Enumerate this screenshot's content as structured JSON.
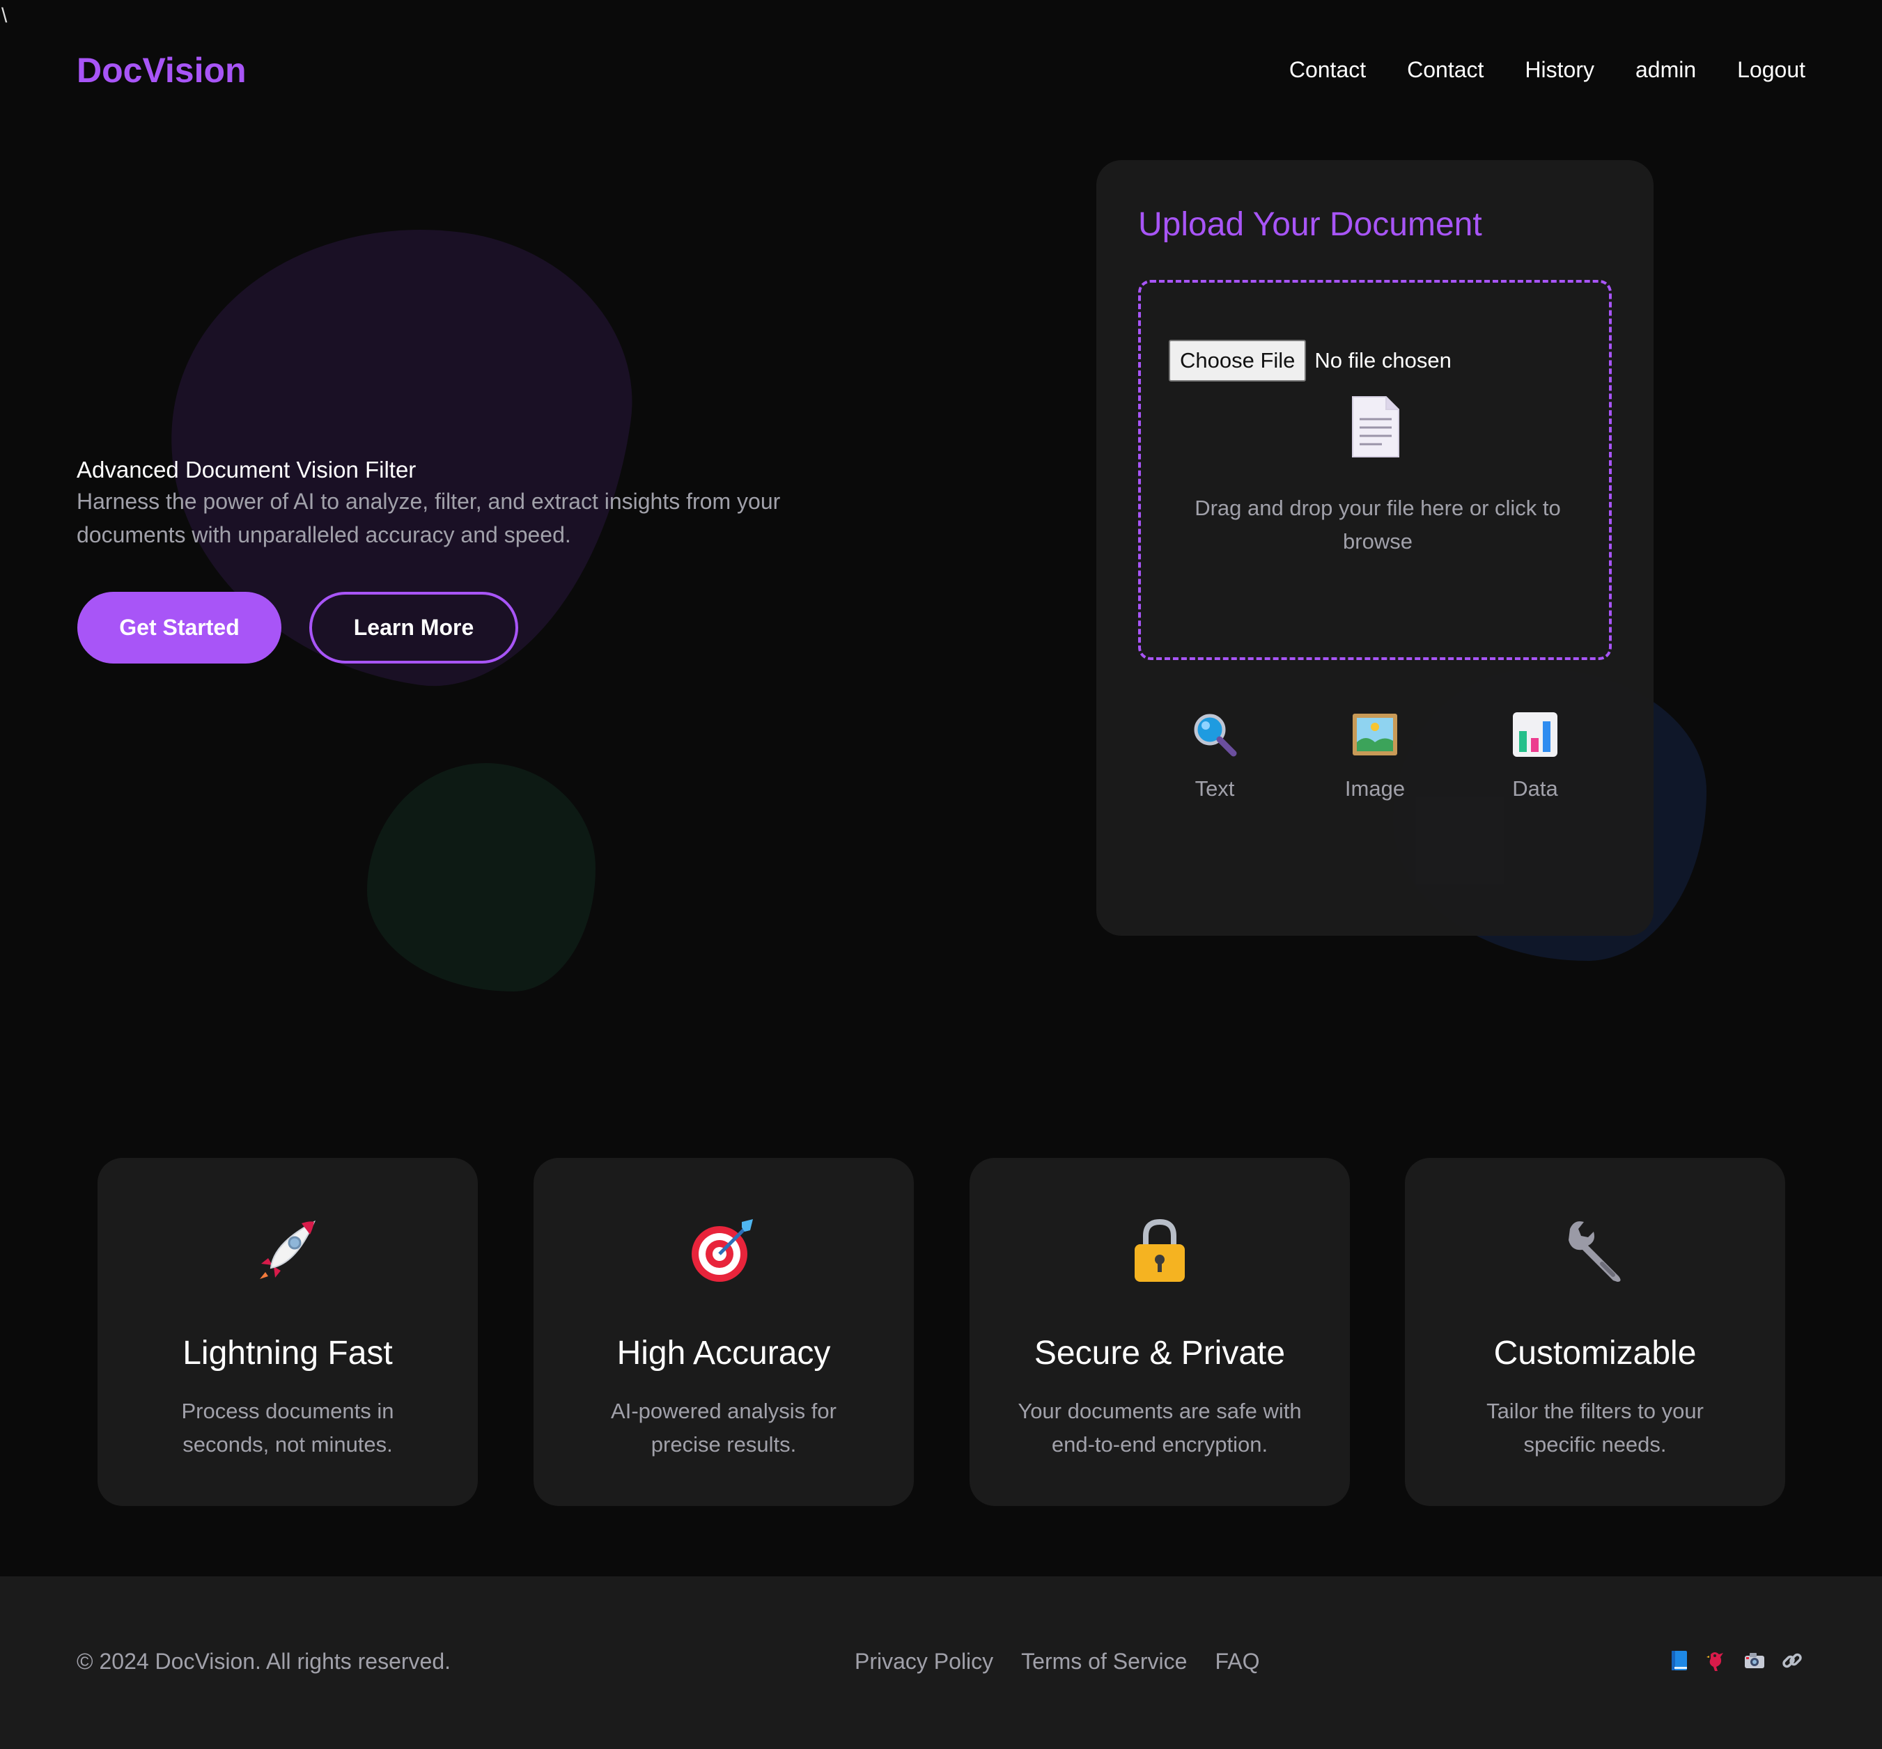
{
  "stray_text": "\\",
  "brand": "DocVision",
  "nav": [
    "Contact",
    "Contact",
    "History",
    "admin",
    "Logout"
  ],
  "hero": {
    "title": "Advanced Document Vision Filter",
    "description": "Harness the power of AI to analyze, filter, and extract insights from your documents with unparalleled accuracy and speed.",
    "primary_button": "Get Started",
    "secondary_button": "Learn More"
  },
  "upload": {
    "title": "Upload Your Document",
    "choose_button": "Choose File",
    "file_status": "No file chosen",
    "drop_text": "Drag and drop your file here or click to browse",
    "options": [
      {
        "label": "Text",
        "icon": "magnifier-icon"
      },
      {
        "label": "Image",
        "icon": "picture-icon"
      },
      {
        "label": "Data",
        "icon": "bar-chart-icon"
      }
    ]
  },
  "features": [
    {
      "title": "Lightning Fast",
      "description": "Process documents in seconds, not minutes.",
      "icon": "rocket-icon"
    },
    {
      "title": "High Accuracy",
      "description": "AI-powered analysis for precise results.",
      "icon": "target-icon"
    },
    {
      "title": "Secure & Private",
      "description": "Your documents are safe with end-to-end encryption.",
      "icon": "lock-icon"
    },
    {
      "title": "Customizable",
      "description": "Tailor the filters to your specific needs.",
      "icon": "wrench-icon"
    }
  ],
  "footer": {
    "copyright": "© 2024 DocVision. All rights reserved.",
    "links": [
      "Privacy Policy",
      "Terms of Service",
      "FAQ"
    ],
    "social_icons": [
      "book-icon",
      "bird-icon",
      "camera-icon",
      "link-icon"
    ]
  },
  "colors": {
    "accent": "#a855f7",
    "background": "#0a0a0a",
    "card": "#1b1b1b",
    "muted_text": "#a1a1aa"
  }
}
